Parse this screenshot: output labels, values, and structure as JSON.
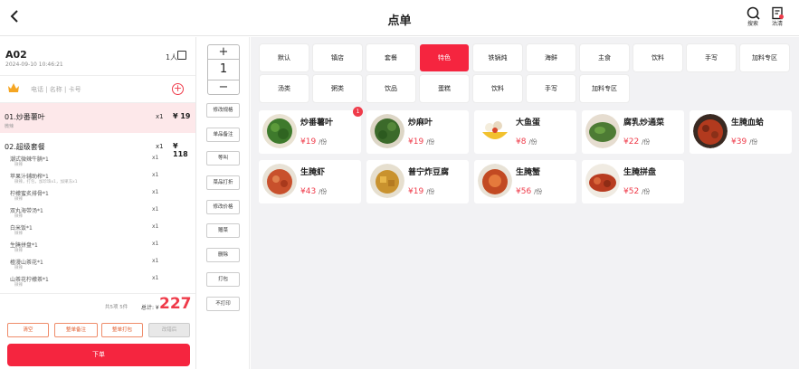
{
  "header": {
    "title": "点单",
    "search_label": "搜索",
    "clear_label": "沽清"
  },
  "order": {
    "table_no": "A02",
    "time": "2024-09-10 10:46:21",
    "people": "1人",
    "member_placeholder": "电话 | 名称 | 卡号",
    "items": [
      {
        "name": "01.炒番薯叶",
        "qty": "x1",
        "price": "¥ 19",
        "note": "微辣"
      },
      {
        "name": "02.超级套餐",
        "qty": "x1",
        "price": "¥ 118"
      }
    ],
    "sub_items": [
      {
        "name": "潮式微辣牛腩*1",
        "qty": "x1",
        "note": "微辣"
      },
      {
        "name": "苹果汁辅助榨*1",
        "qty": "x1",
        "note": "微辣，打包，加珍珠x1，加果冻x1"
      },
      {
        "name": "柠檬蜜炙排骨*1",
        "qty": "x1",
        "note": "微辣"
      },
      {
        "name": "双丸海带汤*1",
        "qty": "x1",
        "note": "微辣"
      },
      {
        "name": "白米饭*1",
        "qty": "x1",
        "note": "微辣"
      },
      {
        "name": "生腌拼盘*1",
        "qty": "x1",
        "note": "微辣"
      },
      {
        "name": "楂漫山茶花*1",
        "qty": "x1",
        "note": "微辣"
      },
      {
        "name": "山茶花柠檬茶*1",
        "qty": "x1",
        "note": "微辣"
      }
    ],
    "count_text": "共5项 5件",
    "total_label": "总计: ¥",
    "total": "227",
    "buttons": [
      "清空",
      "整单备注",
      "整单打包",
      "改错后"
    ],
    "submit_label": "下单"
  },
  "stepper": {
    "value": "1",
    "plus": "+",
    "minus": "−"
  },
  "actions": [
    "修改规格",
    "单品备注",
    "等叫",
    "菜品打折",
    "修改价格",
    "赠菜",
    "删除",
    "打包",
    "不打印"
  ],
  "categories": [
    "默认",
    "镇店",
    "套餐",
    "特色",
    "铁锅炖",
    "海鲜",
    "主食",
    "饮料",
    "手写",
    "加料专区",
    "汤类",
    "粥类",
    "饮品",
    "蛋糕",
    "饮料",
    "手写",
    "加料专区"
  ],
  "active_category": "特色",
  "dishes": [
    {
      "name": "炒番薯叶",
      "price": "¥19",
      "unit": "/份",
      "badge": "1"
    },
    {
      "name": "炒麻叶",
      "price": "¥19",
      "unit": "/份"
    },
    {
      "name": "大鱼蛋",
      "price": "¥8",
      "unit": "/份"
    },
    {
      "name": "腐乳炒通菜",
      "price": "¥22",
      "unit": "/份"
    },
    {
      "name": "生腌血蛤",
      "price": "¥39",
      "unit": "/份"
    },
    {
      "name": "生腌虾",
      "price": "¥43",
      "unit": "/份"
    },
    {
      "name": "普宁炸豆腐",
      "price": "¥19",
      "unit": "/份"
    },
    {
      "name": "生腌蟹",
      "price": "¥56",
      "unit": "/份"
    },
    {
      "name": "生腌拼盘",
      "price": "¥52",
      "unit": "/份"
    }
  ],
  "colors": {
    "accent": "#f5253f",
    "price": "#ef3b4a"
  }
}
